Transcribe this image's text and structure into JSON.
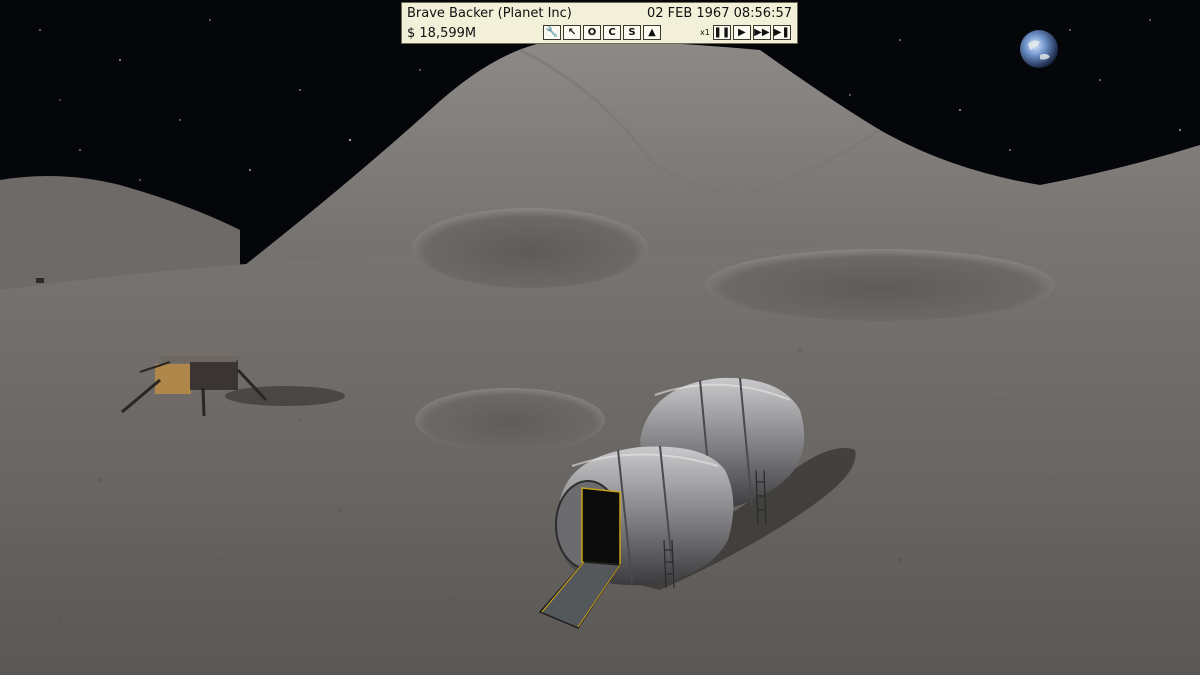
{
  "hud": {
    "company": "Brave Backer (Planet Inc)",
    "date": "02 FEB 1967 08:56:57",
    "money": "$ 18,599M",
    "speed_label": "x1",
    "tool_buttons": [
      {
        "name": "wrench-icon",
        "glyph": "🔧"
      },
      {
        "name": "cursor-icon",
        "glyph": "↖"
      },
      {
        "name": "o-button",
        "glyph": "O"
      },
      {
        "name": "c-button",
        "glyph": "C"
      },
      {
        "name": "s-button",
        "glyph": "S"
      },
      {
        "name": "triangle-icon",
        "glyph": "▲"
      }
    ],
    "speed_buttons": [
      {
        "name": "pause-icon",
        "glyph": "❚❚"
      },
      {
        "name": "play-icon",
        "glyph": "▶"
      },
      {
        "name": "fast-forward-icon",
        "glyph": "▶▶"
      },
      {
        "name": "skip-forward-icon",
        "glyph": "▶❚"
      }
    ]
  },
  "colors": {
    "hud_bg": "#f2f0d8",
    "sky": "#05060a",
    "regolith": "#7b7774"
  }
}
